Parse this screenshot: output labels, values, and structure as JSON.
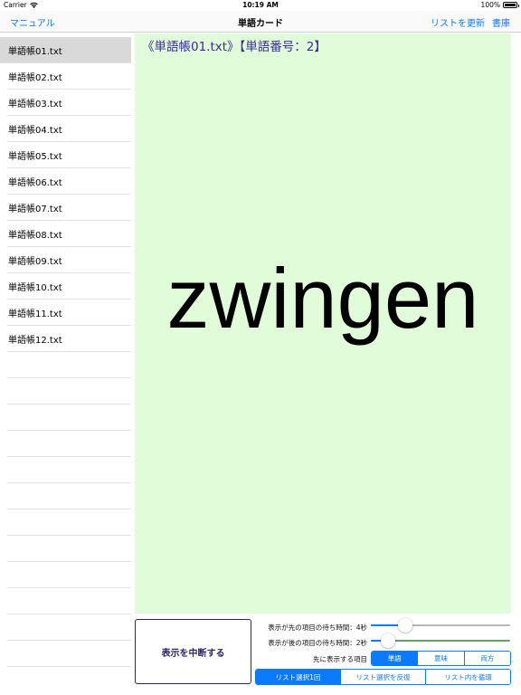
{
  "status_bar": {
    "carrier": "Carrier",
    "time": "10:19 AM",
    "battery": "100%",
    "wifi_icon": "wifi-icon",
    "battery_icon": "battery-icon"
  },
  "nav": {
    "left": "マニュアル",
    "title": "単語カード",
    "refresh": "リストを更新",
    "library": "書庫"
  },
  "sidebar": {
    "items": [
      "単語帳01.txt",
      "単語帳02.txt",
      "単語帳03.txt",
      "単語帳04.txt",
      "単語帳05.txt",
      "単語帳06.txt",
      "単語帳07.txt",
      "単語帳08.txt",
      "単語帳09.txt",
      "単語帳10.txt",
      "単語帳11.txt",
      "単語帳12.txt"
    ],
    "selected_index": 0
  },
  "card": {
    "header": "《単語帳01.txt》【単語番号：2】",
    "word": "zwingen"
  },
  "controls": {
    "stop_label": "表示を中断する",
    "first_wait_label": "表示が先の項目の待ち時間：4秒",
    "first_wait_value": 4,
    "second_wait_label": "表示が後の項目の待ち時間：2秒",
    "second_wait_value": 2,
    "first_item_label": "先に表示する項目",
    "first_item_options": [
      "単語",
      "意味",
      "両方"
    ],
    "first_item_selected": 0,
    "list_mode_options": [
      "リスト選択1回",
      "リスト選択を反復",
      "リスト内を循環"
    ],
    "list_mode_selected": 0
  },
  "colors": {
    "accent": "#0a7aff",
    "card_background": "#e1fcd8",
    "header_text": "#3a2a9a"
  }
}
